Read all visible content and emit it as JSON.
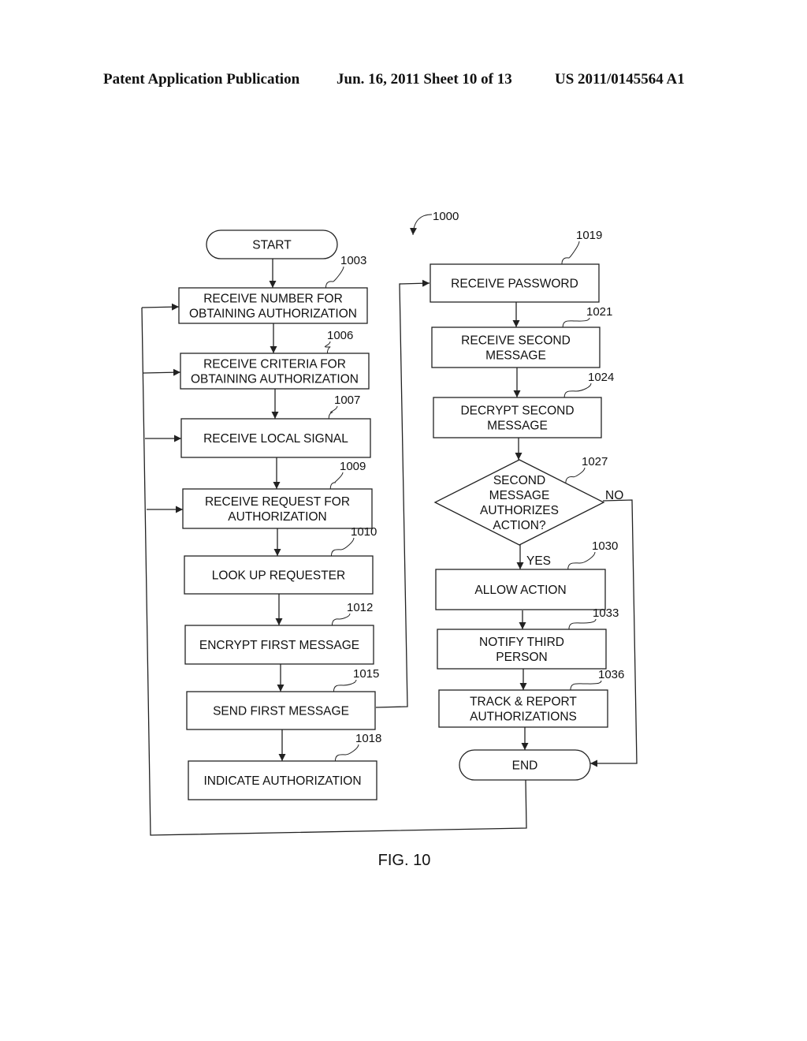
{
  "header": {
    "publication": "Patent Application Publication",
    "date_sheet": "Jun. 16, 2011  Sheet 10 of 13",
    "number": "US 2011/0145564 A1"
  },
  "figure": {
    "label": "FIG. 10",
    "ref": "1000"
  },
  "nodes": {
    "start": {
      "type": "terminal",
      "lines": [
        "START"
      ]
    },
    "n1003": {
      "ref": "1003",
      "type": "process",
      "lines": [
        "RECEIVE NUMBER FOR",
        "OBTAINING AUTHORIZATION"
      ]
    },
    "n1006": {
      "ref": "1006",
      "type": "process",
      "lines": [
        "RECEIVE CRITERIA FOR",
        "OBTAINING AUTHORIZATION"
      ]
    },
    "n1007": {
      "ref": "1007",
      "type": "process",
      "lines": [
        "RECEIVE LOCAL SIGNAL"
      ]
    },
    "n1009": {
      "ref": "1009",
      "type": "process",
      "lines": [
        "RECEIVE REQUEST FOR",
        "AUTHORIZATION"
      ]
    },
    "n1010": {
      "ref": "1010",
      "type": "process",
      "lines": [
        "LOOK UP REQUESTER"
      ]
    },
    "n1012": {
      "ref": "1012",
      "type": "process",
      "lines": [
        "ENCRYPT FIRST MESSAGE"
      ]
    },
    "n1015": {
      "ref": "1015",
      "type": "process",
      "lines": [
        "SEND FIRST MESSAGE"
      ]
    },
    "n1018": {
      "ref": "1018",
      "type": "process",
      "lines": [
        "INDICATE AUTHORIZATION"
      ]
    },
    "n1019": {
      "ref": "1019",
      "type": "process",
      "lines": [
        "RECEIVE PASSWORD"
      ]
    },
    "n1021": {
      "ref": "1021",
      "type": "process",
      "lines": [
        "RECEIVE SECOND",
        "MESSAGE"
      ]
    },
    "n1024": {
      "ref": "1024",
      "type": "process",
      "lines": [
        "DECRYPT SECOND",
        "MESSAGE"
      ]
    },
    "n1027": {
      "ref": "1027",
      "type": "decision",
      "lines": [
        "SECOND",
        "MESSAGE",
        "AUTHORIZES",
        "ACTION?"
      ]
    },
    "n1030": {
      "ref": "1030",
      "type": "process",
      "lines": [
        "ALLOW ACTION"
      ]
    },
    "n1033": {
      "ref": "1033",
      "type": "process",
      "lines": [
        "NOTIFY THIRD",
        "PERSON"
      ]
    },
    "n1036": {
      "ref": "1036",
      "type": "process",
      "lines": [
        "TRACK & REPORT",
        "AUTHORIZATIONS"
      ]
    },
    "end": {
      "type": "terminal",
      "lines": [
        "END"
      ]
    }
  },
  "edge_labels": {
    "yes": "YES",
    "no": "NO"
  },
  "edges": [
    [
      "start",
      "n1003"
    ],
    [
      "n1003",
      "n1006"
    ],
    [
      "n1006",
      "n1007"
    ],
    [
      "n1007",
      "n1009"
    ],
    [
      "n1009",
      "n1010"
    ],
    [
      "n1010",
      "n1012"
    ],
    [
      "n1012",
      "n1015"
    ],
    [
      "n1015",
      "n1018"
    ],
    [
      "n1015",
      "n1019"
    ],
    [
      "n1019",
      "n1021"
    ],
    [
      "n1021",
      "n1024"
    ],
    [
      "n1024",
      "n1027"
    ],
    [
      "n1027",
      "n1030",
      "YES"
    ],
    [
      "n1027",
      "end",
      "NO"
    ],
    [
      "n1030",
      "n1033"
    ],
    [
      "n1033",
      "n1036"
    ],
    [
      "n1036",
      "end"
    ],
    [
      "end",
      "n1003"
    ],
    [
      "end",
      "n1006"
    ],
    [
      "end",
      "n1007"
    ],
    [
      "end",
      "n1009"
    ]
  ]
}
